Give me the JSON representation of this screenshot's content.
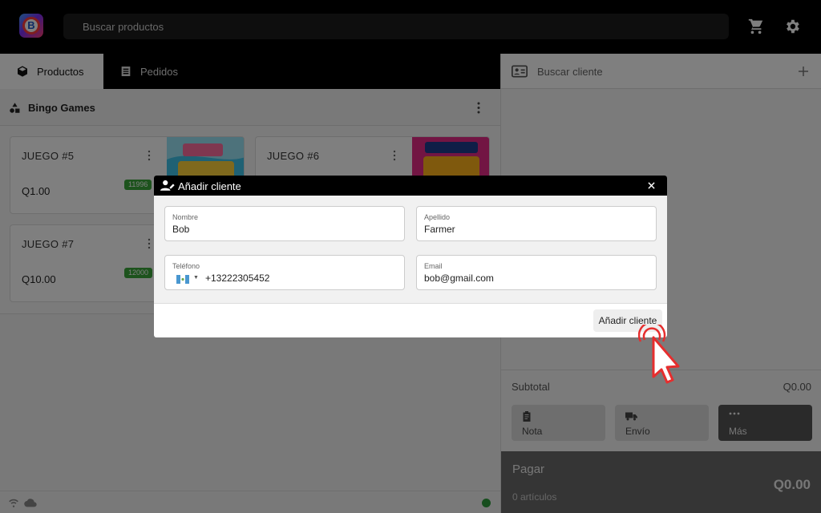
{
  "colors": {
    "accent": "#000000",
    "status_online": "#2e9c3c",
    "badge": "#3aa63a",
    "cursor": "#e62e2e"
  },
  "header": {
    "search_placeholder": "Buscar productos",
    "logo_letter": "B"
  },
  "tabs": [
    {
      "label": "Productos",
      "icon": "cube-icon",
      "active": true
    },
    {
      "label": "Pedidos",
      "icon": "list-icon",
      "active": false
    }
  ],
  "section": {
    "title": "Bingo Games"
  },
  "products": [
    {
      "name": "JUEGO #5",
      "price": "Q1.00",
      "badge": "11996"
    },
    {
      "name": "JUEGO #6",
      "price": "",
      "badge": ""
    },
    {
      "name": "JUEGO #7",
      "price": "Q10.00",
      "badge": "12000"
    }
  ],
  "cart": {
    "customer_placeholder": "Buscar cliente",
    "subtotal_label": "Subtotal",
    "subtotal_value": "Q0.00",
    "actions": [
      {
        "label": "Nota",
        "icon": "clipboard-icon"
      },
      {
        "label": "Envío",
        "icon": "truck-icon"
      },
      {
        "label": "Más",
        "icon": "more-icon"
      }
    ],
    "pay_label": "Pagar",
    "item_count": "0 artículos",
    "total": "Q0.00"
  },
  "modal": {
    "title": "Añadir cliente",
    "fields": {
      "first_name": {
        "label": "Nombre",
        "value": "Bob"
      },
      "last_name": {
        "label": "Apellido",
        "value": "Farmer"
      },
      "phone": {
        "label": "Teléfono",
        "value": "+13222305452"
      },
      "email": {
        "label": "Email",
        "value": "bob@gmail.com"
      }
    },
    "submit_label": "Añadir cliente"
  }
}
